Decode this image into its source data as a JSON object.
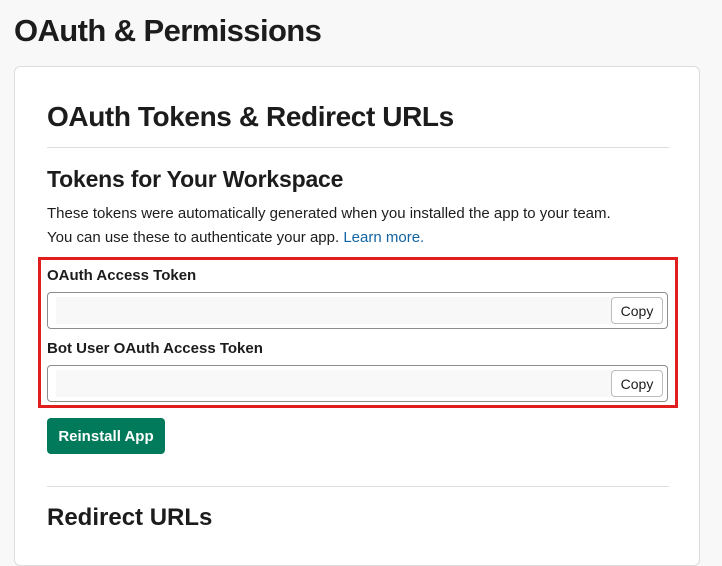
{
  "page": {
    "title": "OAuth & Permissions"
  },
  "oauth_section": {
    "title": "OAuth Tokens & Redirect URLs",
    "tokens": {
      "title": "Tokens for Your Workspace",
      "description_line1": "These tokens were automatically generated when you installed the app to your team.",
      "description_line2": "You can use these to authenticate your app.",
      "learn_more": "Learn more.",
      "fields": [
        {
          "label": "OAuth Access Token",
          "value": "",
          "copy_label": "Copy"
        },
        {
          "label": "Bot User OAuth Access Token",
          "value": "",
          "copy_label": "Copy"
        }
      ],
      "reinstall_label": "Reinstall App"
    }
  },
  "redirect_section": {
    "title": "Redirect URLs"
  },
  "colors": {
    "primary_button": "#007a5a",
    "link": "#1264a3",
    "highlight": "#e01e1e"
  }
}
